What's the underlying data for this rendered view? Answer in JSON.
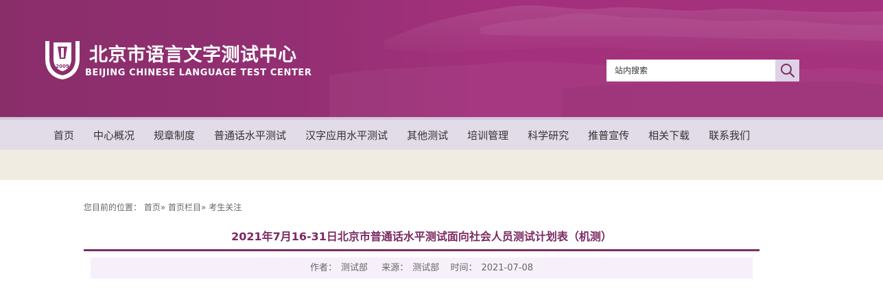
{
  "header": {
    "logo_cn": "北京市语言文字测试中心",
    "logo_en": "BEIJING CHINESE LANGUAGE TEST CENTER",
    "logo_emblem_text": "2009",
    "search_placeholder": "站内搜索",
    "search_icon": "search-icon"
  },
  "nav": {
    "items": [
      {
        "label": "首页"
      },
      {
        "label": "中心概况"
      },
      {
        "label": "规章制度"
      },
      {
        "label": "普通话水平测试"
      },
      {
        "label": "汉字应用水平测试"
      },
      {
        "label": "其他测试"
      },
      {
        "label": "培训管理"
      },
      {
        "label": "科学研究"
      },
      {
        "label": "推普宣传"
      },
      {
        "label": "相关下载"
      },
      {
        "label": "联系我们"
      }
    ]
  },
  "breadcrumb": {
    "prefix": "您目前的位置：",
    "home": "首页",
    "sep1": "»",
    "section": "首页栏目",
    "sep2": "»",
    "current": "考生关注"
  },
  "article": {
    "title": "2021年7月16-31日北京市普通话水平测试面向社会人员测试计划表（机测）",
    "author_label": "作者：",
    "author": "测试部",
    "source_label": "来源：",
    "source": "测试部",
    "time_label": "时间：",
    "time": "2021-07-08"
  },
  "colors": {
    "banner": "#a4327d",
    "nav_bg": "#e2dbe8",
    "title": "#7a2a62",
    "rule": "#7b2d5f",
    "meta_bg": "#f7f0fb",
    "strip": "#f1ece1"
  }
}
